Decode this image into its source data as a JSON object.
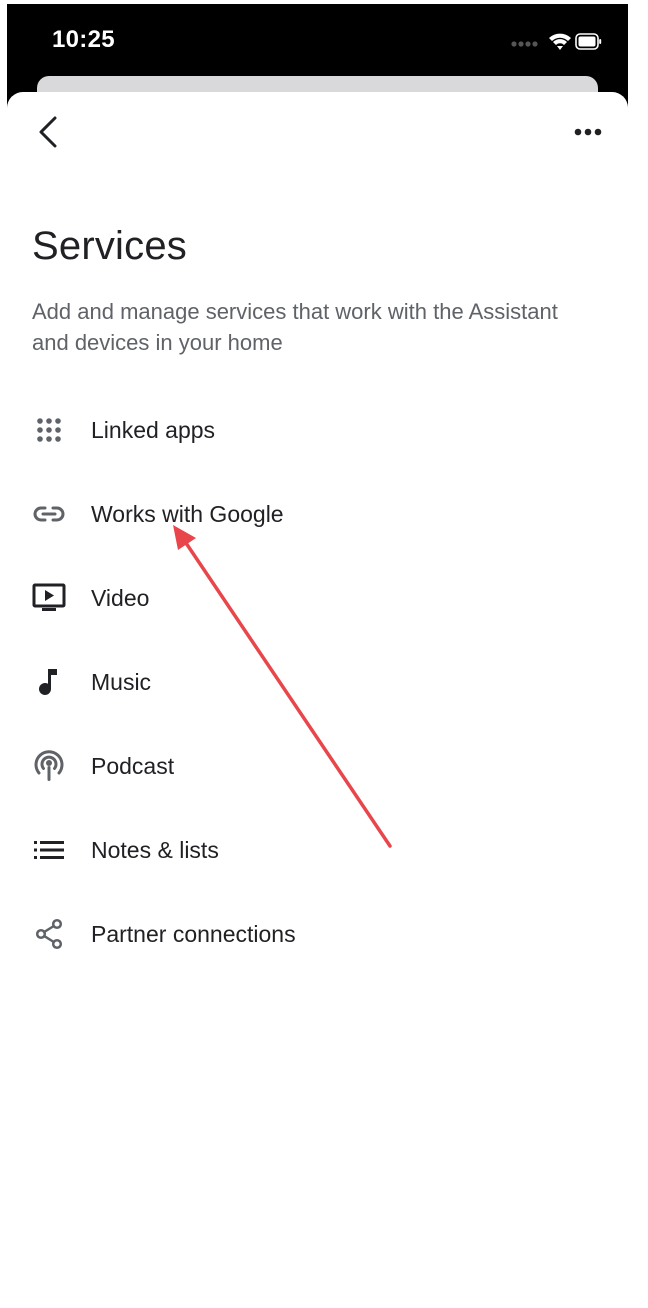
{
  "status_bar": {
    "time": "10:25",
    "icons": [
      "signal-icon",
      "wifi-icon",
      "battery-icon"
    ]
  },
  "header": {
    "back_icon": "chevron-left-icon",
    "more_icon": "more-horizontal-icon"
  },
  "page": {
    "title": "Services",
    "subtitle": "Add and manage services that work with the Assistant and devices in your home"
  },
  "services": [
    {
      "label": "Linked apps",
      "icon": "apps-grid-icon"
    },
    {
      "label": "Works with Google",
      "icon": "link-icon"
    },
    {
      "label": "Video",
      "icon": "video-icon"
    },
    {
      "label": "Music",
      "icon": "music-note-icon"
    },
    {
      "label": "Podcast",
      "icon": "podcast-icon"
    },
    {
      "label": "Notes & lists",
      "icon": "list-icon"
    },
    {
      "label": "Partner connections",
      "icon": "share-icon"
    }
  ],
  "colors": {
    "text_primary": "#202124",
    "text_secondary": "#5f6368",
    "icon": "#5f6368",
    "annotation_arrow": "#e8464b"
  }
}
